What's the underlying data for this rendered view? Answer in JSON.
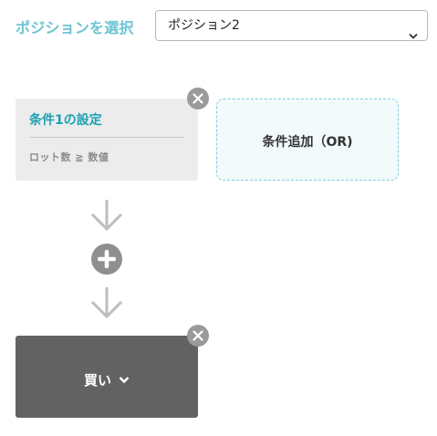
{
  "position_selector": {
    "label": "ポジションを選択",
    "selected": "ポジション2"
  },
  "condition": {
    "title": "条件1の設定",
    "formula": "ロット数 ≧ 数値"
  },
  "add_or": {
    "label": "条件追加（OR)"
  },
  "action": {
    "label": "買い"
  },
  "colors": {
    "accent": "#1aa1b3",
    "label_teal": "#6cc4d2",
    "card_bg": "#ececec",
    "action_bg": "#626262",
    "dashed_border": "#7fd0dc"
  }
}
